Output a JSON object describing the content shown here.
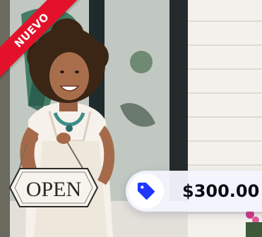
{
  "listing": {
    "badge": {
      "label": "NUEVO",
      "color": "#e3122a"
    },
    "sign": {
      "text": "OPEN"
    },
    "price": {
      "amount": "$300.00",
      "icon": "price-tag-icon",
      "icon_color": "#1f36ff"
    }
  }
}
